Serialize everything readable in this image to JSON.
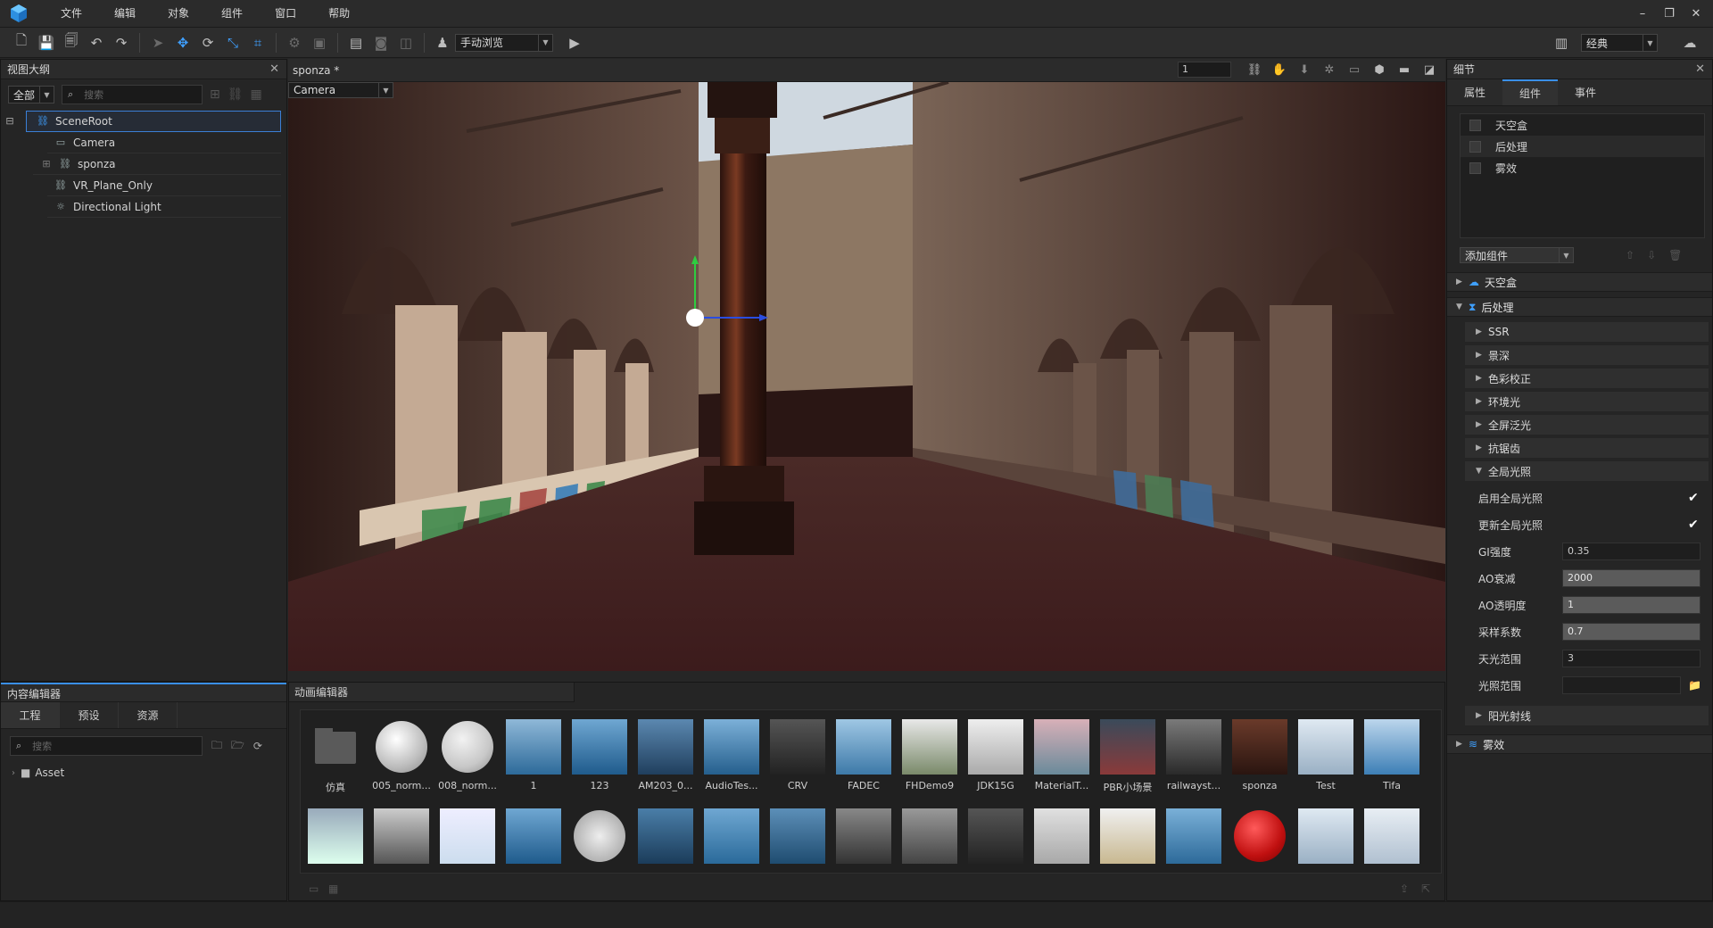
{
  "menu": [
    "文件",
    "编辑",
    "对象",
    "组件",
    "窗口",
    "帮助"
  ],
  "toolbar": {
    "view_mode": "手动浏览",
    "layout": "经典"
  },
  "outline": {
    "title": "视图大纲",
    "filter": "全部",
    "search_placeholder": "搜索",
    "nodes": [
      "SceneRoot",
      "Camera",
      "sponza",
      "VR_Plane_Only",
      "Directional Light"
    ]
  },
  "viewport": {
    "tab": "sponza *",
    "camera": "Camera",
    "frame_value": "1"
  },
  "details": {
    "title": "细节",
    "tabs": [
      "属性",
      "组件",
      "事件"
    ],
    "components": [
      "天空盒",
      "后处理",
      "雾效"
    ],
    "add_component": "添加组件",
    "sections": {
      "skybox": "天空盒",
      "post": "后处理",
      "fog": "雾效"
    },
    "post_items": [
      "SSR",
      "景深",
      "色彩校正",
      "环境光",
      "全屏泛光",
      "抗锯齿",
      "全局光照"
    ],
    "gi": {
      "enable_label": "启用全局光照",
      "update_label": "更新全局光照",
      "gi_strength_label": "GI强度",
      "gi_strength": "0.35",
      "ao_decay_label": "AO衰减",
      "ao_decay": "2000",
      "ao_opacity_label": "AO透明度",
      "ao_opacity": "1",
      "sample_label": "采样系数",
      "sample": "0.7",
      "sky_range_label": "天光范围",
      "sky_range": "3",
      "light_range_label": "光照范围",
      "light_range": ""
    },
    "sun_rays": "阳光射线"
  },
  "content_editor": {
    "title": "内容编辑器",
    "tabs": [
      "工程",
      "预设",
      "资源"
    ],
    "search_placeholder": "搜索",
    "folder": "Asset"
  },
  "anim_editor": {
    "title": "动画编辑器",
    "assets_row1": [
      "仿真",
      "005_norm...",
      "008_norm...",
      "1",
      "123",
      "AM203_0...",
      "AudioTes...",
      "CRV",
      "FADEC",
      "FHDemo9",
      "JDK15G",
      "MaterialT...",
      "PBR小场景",
      "railwayst...",
      "sponza",
      "Test",
      "Tifa"
    ]
  }
}
